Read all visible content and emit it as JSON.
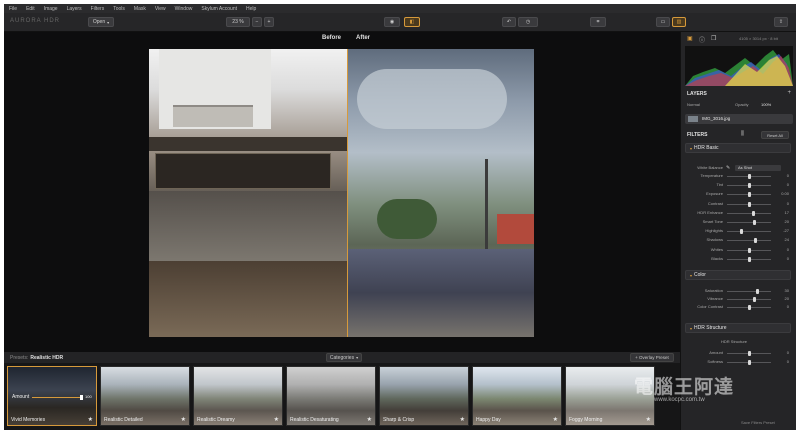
{
  "menu": [
    "File",
    "Edit",
    "Image",
    "Layers",
    "Filters",
    "Tools",
    "Mask",
    "View",
    "Window",
    "Skylum Account",
    "Help"
  ],
  "toolbar": {
    "open_label": "Open",
    "zoom_label": "23 %",
    "app_name_partial": "AURORA HDR"
  },
  "canvas": {
    "before_label": "Before",
    "after_label": "After"
  },
  "strip": {
    "presets_prefix": "Presets:",
    "presets_name": "Realistic HDR",
    "categories_label": "Categories",
    "overlay_label": "+ Overlay Preset",
    "amount_label": "Amount",
    "amount_value": "100",
    "thumbs": [
      {
        "name": "Vivid Memories"
      },
      {
        "name": "Realistic Detailed"
      },
      {
        "name": "Realistic Dreamy"
      },
      {
        "name": "Realistic Desaturating"
      },
      {
        "name": "Sharp & Crisp"
      },
      {
        "name": "Happy Day"
      },
      {
        "name": "Foggy Morning"
      }
    ]
  },
  "panel": {
    "info_text": "4105 × 3014 px · 8 bit",
    "layers_title": "LAYERS",
    "blend_label": "Normal",
    "opacity_label": "Opacity",
    "opacity_value": "100%",
    "layer_name": "IMG_3016.jpg",
    "filters_title": "FILTERS",
    "reset_all": "Reset All",
    "hdr_basic": "HDR Basic",
    "white_balance_label": "White Balance",
    "white_balance_value": "As Shot",
    "color": "Color",
    "hdr_structure": "HDR Structure",
    "structure_sub": "HDR Structure",
    "save_preset": "Save Filters Preset",
    "basic_sliders": [
      {
        "label": "Temperature",
        "value": "0",
        "pos": 0.5
      },
      {
        "label": "Tint",
        "value": "0",
        "pos": 0.5
      },
      {
        "label": "Exposure",
        "value": "0.00",
        "pos": 0.5
      },
      {
        "label": "Contrast",
        "value": "0",
        "pos": 0.5
      },
      {
        "label": "HDR Enhance",
        "value": "17",
        "pos": 0.62
      },
      {
        "label": "Smart Tone",
        "value": "20",
        "pos": 0.64
      },
      {
        "label": "Highlights",
        "value": "-27",
        "pos": 0.32
      },
      {
        "label": "Shadows",
        "value": "24",
        "pos": 0.66
      },
      {
        "label": "Whites",
        "value": "0",
        "pos": 0.5
      },
      {
        "label": "Blacks",
        "value": "0",
        "pos": 0.5
      }
    ],
    "color_sliders": [
      {
        "label": "Saturation",
        "value": "30",
        "pos": 0.7
      },
      {
        "label": "Vibrance",
        "value": "20",
        "pos": 0.64
      },
      {
        "label": "Color Contrast",
        "value": "0",
        "pos": 0.5
      }
    ],
    "structure_sliders": [
      {
        "label": "Amount",
        "value": "0",
        "pos": 0.5
      },
      {
        "label": "Softness",
        "value": "0",
        "pos": 0.5
      }
    ]
  },
  "watermark": {
    "text": "電腦王阿達",
    "url": "www.kocpc.com.tw"
  },
  "colors": {
    "accent": "#d79a3b",
    "background": "#1c1c1e",
    "panel": "#252527"
  }
}
